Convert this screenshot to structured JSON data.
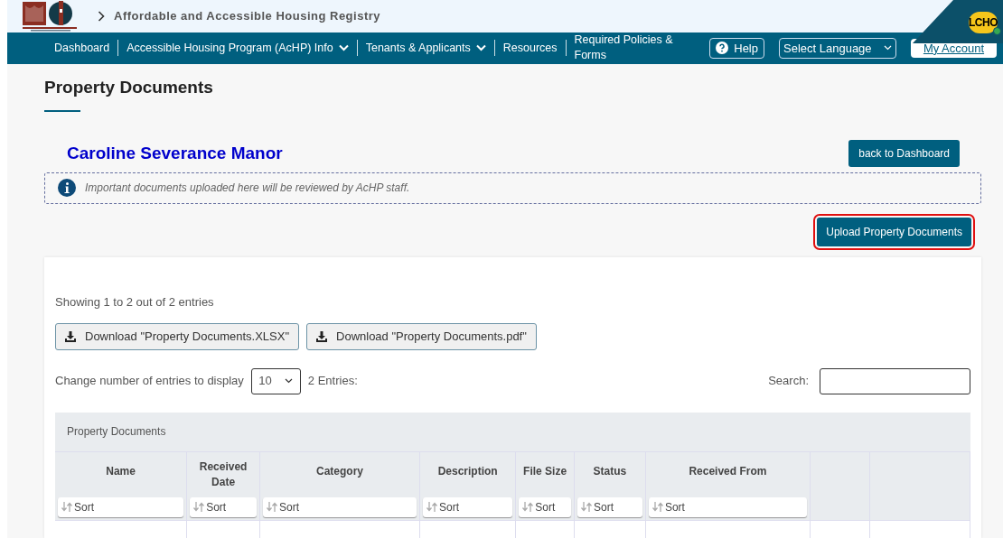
{
  "header": {
    "breadcrumb": "Affordable and Accessible Housing Registry",
    "avatar": "LCHO",
    "avatar_online": true
  },
  "nav": {
    "items": [
      {
        "label": "Dashboard",
        "dropdown": false
      },
      {
        "label": "Accessible Housing Program (AcHP) Info",
        "dropdown": true
      },
      {
        "label": "Tenants & Applicants",
        "dropdown": true
      },
      {
        "label": "Resources",
        "dropdown": false
      },
      {
        "label": "Required Policies & Forms",
        "dropdown": false
      }
    ],
    "help": "Help",
    "language": "Select Language",
    "account": "My Account"
  },
  "page": {
    "title": "Property Documents",
    "property": "Caroline Severance Manor",
    "back_button": "back to Dashboard",
    "notice": "Important documents uploaded here will be reviewed by AcHP staff.",
    "upload_button": {
      "label": "Upload Property Documents",
      "highlighted": true
    }
  },
  "table_panel": {
    "showing": "Showing 1 to 2 out of 2 entries",
    "downloads": [
      "Download \"Property Documents.XLSX\"",
      "Download \"Property Documents.pdf\""
    ],
    "entries_label": "Change number of entries to display",
    "entries_value": "10",
    "entries_count": "2 Entries:",
    "search_label": "Search:",
    "table_title": "Property Documents",
    "columns": [
      {
        "label": "Name",
        "sort": "Sort"
      },
      {
        "label": "Received Date",
        "sort": "Sort"
      },
      {
        "label": "Category",
        "sort": "Sort"
      },
      {
        "label": "Description",
        "sort": "Sort"
      },
      {
        "label": "File Size",
        "sort": "Sort"
      },
      {
        "label": "Status",
        "sort": "Sort"
      },
      {
        "label": "Received From",
        "sort": "Sort"
      },
      {},
      {}
    ]
  }
}
